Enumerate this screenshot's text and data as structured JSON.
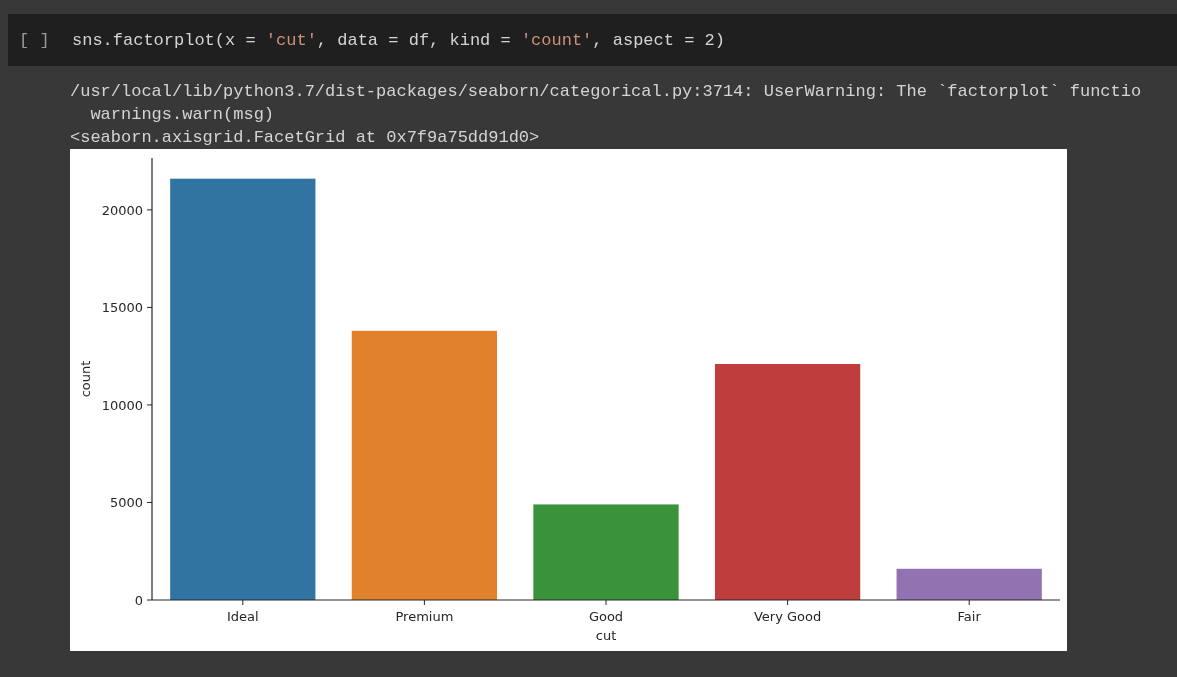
{
  "code_cell": {
    "run_marker": "[ ]",
    "code": [
      {
        "kind": "plain",
        "text": "sns.factorplot(x = "
      },
      {
        "kind": "string",
        "text": "'cut'"
      },
      {
        "kind": "plain",
        "text": ", data = df, kind = "
      },
      {
        "kind": "string",
        "text": "'count'"
      },
      {
        "kind": "plain",
        "text": ", aspect = 2)"
      }
    ]
  },
  "output": {
    "lines": [
      "/usr/local/lib/python3.7/dist-packages/seaborn/categorical.py:3714: UserWarning: The `factorplot` functio",
      "  warnings.warn(msg)",
      "<seaborn.axisgrid.FacetGrid at 0x7f9a75dd91d0>"
    ],
    "chart_data": {
      "type": "bar",
      "xlabel": "cut",
      "ylabel": "count",
      "categories": [
        "Ideal",
        "Premium",
        "Good",
        "Very Good",
        "Fair"
      ],
      "series": [
        {
          "color": "#3274a1",
          "values": [
            21600,
            null,
            null,
            null,
            null
          ]
        },
        {
          "color": "#e1812c",
          "values": [
            null,
            13800,
            null,
            null,
            null
          ]
        },
        {
          "color": "#3a923a",
          "values": [
            null,
            null,
            4900,
            null,
            null
          ]
        },
        {
          "color": "#c03d3e",
          "values": [
            null,
            null,
            null,
            12100,
            null
          ]
        },
        {
          "color": "#9372b2",
          "values": [
            null,
            null,
            null,
            null,
            1600
          ]
        }
      ],
      "ylim": [
        0,
        22660
      ],
      "yticks": [
        0,
        5000,
        10000,
        15000,
        20000
      ]
    }
  }
}
